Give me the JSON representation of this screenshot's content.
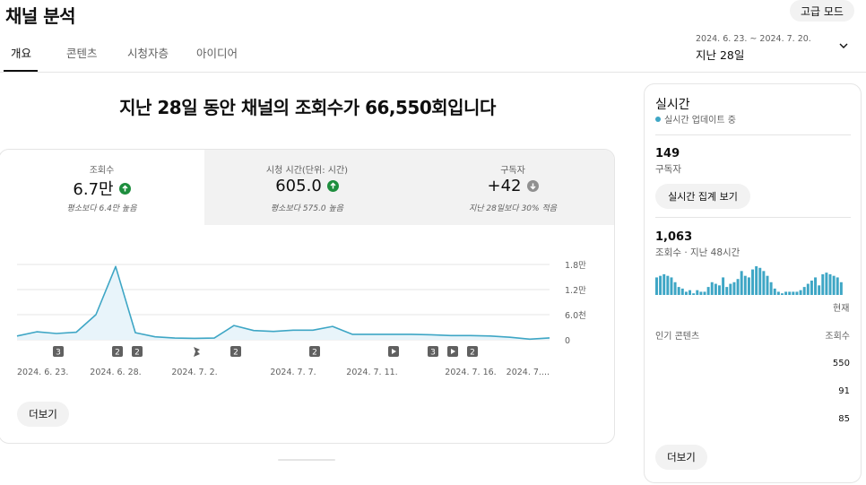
{
  "header": {
    "title": "채널 분석",
    "advanced_mode_label": "고급 모드",
    "tabs": [
      {
        "label": "개요",
        "active": true
      },
      {
        "label": "콘텐츠",
        "active": false
      },
      {
        "label": "시청자층",
        "active": false
      },
      {
        "label": "아이디어",
        "active": false
      }
    ],
    "date_range": "2024. 6. 23. ~ 2024. 7. 20.",
    "date_label": "지난 28일"
  },
  "headline": "지난 28일 동안 채널의 조회수가 66,550회입니다",
  "metrics": [
    {
      "label": "조회수",
      "value": "6.7만",
      "trend": "up",
      "sub": "평소보다 6.4만 높음"
    },
    {
      "label": "시청 시간(단위: 시간)",
      "value": "605.0",
      "trend": "up",
      "sub": "평소보다 575.0 높음"
    },
    {
      "label": "구독자",
      "value": "+42",
      "trend": "down",
      "sub": "지난 28일보다 30% 적음"
    }
  ],
  "chart_data": {
    "type": "area",
    "y_ticks": [
      "1.8만",
      "1.2만",
      "6.0천",
      "0"
    ],
    "ylim": [
      0,
      18000
    ],
    "x_tick_labels": [
      "2024. 6. 23.",
      "2024. 6. 28.",
      "2024. 7. 2.",
      "2024. 7. 7.",
      "2024. 7. 11.",
      "2024. 7. 16.",
      "2024. 7...."
    ],
    "x_tick_index": [
      0,
      5,
      9,
      14,
      18,
      23,
      27
    ],
    "x": [
      "6/23",
      "6/24",
      "6/25",
      "6/26",
      "6/27",
      "6/28",
      "6/29",
      "6/30",
      "7/1",
      "7/2",
      "7/3",
      "7/4",
      "7/5",
      "7/6",
      "7/7",
      "7/8",
      "7/9",
      "7/10",
      "7/11",
      "7/12",
      "7/13",
      "7/14",
      "7/15",
      "7/16",
      "7/17",
      "7/18",
      "7/19",
      "7/20"
    ],
    "values": [
      900,
      1900,
      1500,
      1800,
      6000,
      17500,
      1700,
      700,
      400,
      350,
      400,
      3400,
      2200,
      2000,
      2300,
      2300,
      3200,
      1300,
      1300,
      1300,
      1300,
      1200,
      1000,
      1000,
      900,
      600,
      150,
      450
    ],
    "markers": [
      {
        "index": 2,
        "type": "count",
        "label": "3"
      },
      {
        "index": 5,
        "type": "count",
        "label": "2"
      },
      {
        "index": 6,
        "type": "count",
        "label": "2"
      },
      {
        "index": 9,
        "type": "short",
        "label": ""
      },
      {
        "index": 11,
        "type": "count",
        "label": "2"
      },
      {
        "index": 15,
        "type": "count",
        "label": "2"
      },
      {
        "index": 19,
        "type": "video",
        "label": ""
      },
      {
        "index": 21,
        "type": "count",
        "label": "3"
      },
      {
        "index": 22,
        "type": "video",
        "label": ""
      },
      {
        "index": 23,
        "type": "count",
        "label": "2"
      }
    ],
    "colors": {
      "line": "#3ea6c5",
      "fill": "#e8f4fa",
      "grid": "#e5e5e5",
      "marker": "#606060"
    }
  },
  "main_more_label": "더보기",
  "realtime": {
    "title": "실시간",
    "live_text": "실시간 업데이트 중",
    "subscribers_value": "149",
    "subscribers_label": "구독자",
    "live_count_button": "실시간 집계 보기",
    "views_value": "1,063",
    "views_label": "조회수 · 지난 48시간",
    "bars": [
      11,
      12,
      13,
      12,
      11,
      8,
      5,
      4,
      2,
      3,
      1,
      3,
      2,
      2,
      5,
      8,
      7,
      6,
      11,
      5,
      7,
      8,
      10,
      15,
      12,
      11,
      16,
      18,
      17,
      15,
      12,
      8,
      4,
      2,
      1,
      2,
      2,
      2,
      2,
      3,
      5,
      7,
      9,
      11,
      6,
      13,
      14,
      13,
      12,
      11,
      8
    ],
    "now_label": "현재",
    "popular_header": "인기 콘텐츠",
    "views_header": "조회수",
    "popular_values": [
      "550",
      "91",
      "85"
    ],
    "more_label": "더보기",
    "bar_color": "#3ea6c5"
  }
}
